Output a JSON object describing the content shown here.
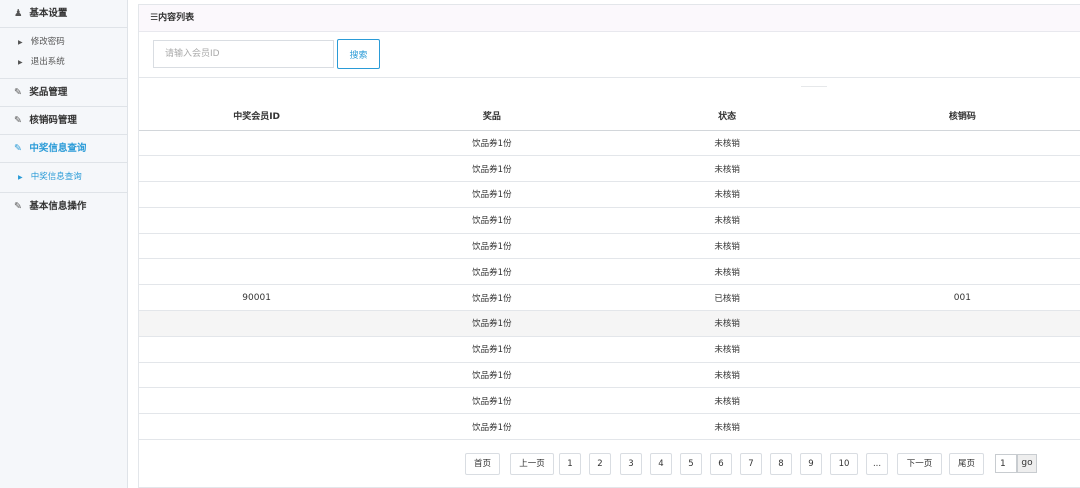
{
  "sidebar": {
    "groups": [
      {
        "label": "基本设置",
        "icon": "user-icon"
      },
      {
        "label": "奖品管理",
        "icon": "edit-icon"
      },
      {
        "label": "核销码管理",
        "icon": "edit-icon"
      },
      {
        "label": "中奖信息查询",
        "icon": "edit-icon"
      },
      {
        "label": "基本信息操作",
        "icon": "edit-icon"
      }
    ],
    "settings_items": [
      "修改密码",
      "退出系统"
    ],
    "query_items": [
      "中奖信息查询"
    ],
    "active_color": "#2a9bd7"
  },
  "panel": {
    "title": "☰内容列表"
  },
  "search": {
    "placeholder": "请输入会员ID",
    "button_label": "搜索"
  },
  "table": {
    "headers": [
      "中奖会员ID",
      "奖品",
      "状态",
      "核销码"
    ],
    "rows": [
      {
        "member_id": "",
        "prize": "饮品券1份",
        "status": "未核销",
        "code": ""
      },
      {
        "member_id": "",
        "prize": "饮品券1份",
        "status": "未核销",
        "code": ""
      },
      {
        "member_id": "",
        "prize": "饮品券1份",
        "status": "未核销",
        "code": ""
      },
      {
        "member_id": "",
        "prize": "饮品券1份",
        "status": "未核销",
        "code": ""
      },
      {
        "member_id": "",
        "prize": "饮品券1份",
        "status": "未核销",
        "code": ""
      },
      {
        "member_id": "",
        "prize": "饮品券1份",
        "status": "未核销",
        "code": ""
      },
      {
        "member_id": "90001",
        "prize": "饮品券1份",
        "status": "已核销",
        "code": "001"
      },
      {
        "member_id": "",
        "prize": "饮品券1份",
        "status": "未核销",
        "code": ""
      },
      {
        "member_id": "",
        "prize": "饮品券1份",
        "status": "未核销",
        "code": ""
      },
      {
        "member_id": "",
        "prize": "饮品券1份",
        "status": "未核销",
        "code": ""
      },
      {
        "member_id": "",
        "prize": "饮品券1份",
        "status": "未核销",
        "code": ""
      },
      {
        "member_id": "",
        "prize": "饮品券1份",
        "status": "未核销",
        "code": ""
      }
    ],
    "highlighted_row": 7
  },
  "pager": {
    "first": "首页",
    "prev": "上一页",
    "pages": [
      "1",
      "2",
      "3",
      "4",
      "5",
      "6",
      "7",
      "8",
      "9",
      "10",
      "..."
    ],
    "next": "下一页",
    "last": "尾页",
    "page_input_value": "1",
    "go_label": "go"
  }
}
